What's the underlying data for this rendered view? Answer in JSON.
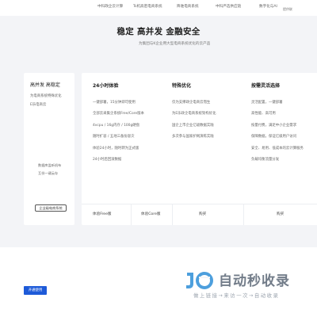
{
  "nav": {
    "items": [
      "中科政企云计算",
      "Ts机高密电商系统",
      "降谁电商系统",
      "中科严选供应链",
      "数字化与AI",
      "提供联"
    ]
  },
  "hero": {
    "title": "稳定 高并发 金融安全",
    "subtitle": "为集团与K企业用大型电商系统优化的云产品"
  },
  "left_panel": {
    "title": "高并发 高稳定",
    "desc1": "为电商系统特殊优化",
    "desc2": "E乐电商云",
    "price1": "数据库监听机布",
    "price2": "互份一键云存",
    "button_label": "企业级电商系统"
  },
  "columns": [
    {
      "title": "24小时体验",
      "features": [
        "一键部署，15分钟即可使用",
        "全部云采集企系统Free/Core版本",
        "4vcpu / 16g内存 / 100g硬盘",
        "随时扩容 / 五地三备份容灾",
        "体验24小时，随时转为正式版",
        "24小时后回滚数据"
      ]
    },
    {
      "title": "特殊优化",
      "features": [
        "仅为支撑政企电商云而生",
        "为E乐政企电商系统架构优化",
        "国企上市企业亿级数据实践",
        "多次参与国家护网演练实践"
      ]
    },
    {
      "title": "按需灵活选择",
      "features": [
        "灵活配置，一键部署",
        "高性能、高可用",
        "按量付费，满足中小企业需求",
        "保障数据，保证亿级用户访问",
        "安全、易用、低成本的云计算服务",
        "负载均衡流量分发"
      ]
    }
  ],
  "footer": {
    "cells": [
      "体验Free版",
      "体验Core版",
      "购买",
      "购买"
    ]
  },
  "bottom": {
    "open_button": "开通使用"
  },
  "watermark": {
    "brand": "自动秒收录",
    "slogan": "做上链接→来访一次→自动收录"
  },
  "colors": {
    "primary": "#1d5ad8",
    "background": "#f3f4f7"
  }
}
